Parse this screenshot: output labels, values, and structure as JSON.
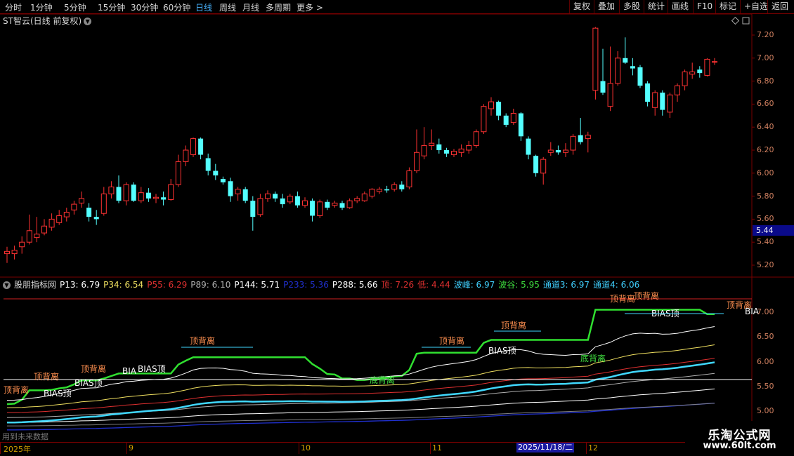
{
  "toolbar": {
    "left_items": [
      "分时",
      "1分钟",
      "5分钟",
      "15分钟",
      "30分钟",
      "60分钟",
      "日线",
      "周线",
      "月线",
      "多周期",
      "更多 >"
    ],
    "active": "日线",
    "right_items": [
      "复权",
      "叠加",
      "多股",
      "统计",
      "画线",
      "F10",
      "标记",
      "+自选",
      "返回"
    ]
  },
  "stock": {
    "title": "ST智云(日线 前复权)"
  },
  "price_axis": {
    "ticks": [
      "7.20",
      "7.00",
      "6.80",
      "6.60",
      "6.40",
      "6.20",
      "6.00",
      "5.80",
      "5.60",
      "5.40",
      "5.20"
    ],
    "current": "5.44"
  },
  "indicator": {
    "name": "股朋指标网",
    "values": [
      {
        "text": "P13: 6.79",
        "color": "#ffffff"
      },
      {
        "text": "P34: 6.54",
        "color": "#f0e060"
      },
      {
        "text": "P55: 6.29",
        "color": "#e03030"
      },
      {
        "text": "P89: 6.10",
        "color": "#b0b0b0"
      },
      {
        "text": "P144: 5.71",
        "color": "#ffffff"
      },
      {
        "text": "P233: 5.36",
        "color": "#2030d0"
      },
      {
        "text": "P288: 5.66",
        "color": "#ffffff"
      },
      {
        "text": "顶: 7.26",
        "color": "#e03030"
      },
      {
        "text": "低: 4.44",
        "color": "#e03030"
      },
      {
        "text": "波峰: 6.97",
        "color": "#40d0ff"
      },
      {
        "text": "波谷: 5.95",
        "color": "#40e040"
      },
      {
        "text": "通道3: 6.97",
        "color": "#40d0ff"
      },
      {
        "text": "通道4: 6.06",
        "color": "#40d0ff"
      }
    ],
    "axis_ticks": [
      "7.00",
      "6.50",
      "6.00",
      "5.50",
      "5.00"
    ]
  },
  "annotations": {
    "top_div": "顶背离",
    "bottom_div": "底背离",
    "bias_top": "BIAS顶",
    "bias_short": "BIA"
  },
  "date_axis": {
    "labels": [
      "2025年",
      "9",
      "10",
      "11",
      "12"
    ],
    "current": "2025/11/18/二"
  },
  "footer": {
    "future_note": "用到未来数据"
  },
  "watermark": {
    "name": "乐淘公式网",
    "url": "www.60lt.com"
  },
  "chart_data": {
    "type": "candlestick",
    "title": "ST智云(日线 前复权)",
    "ylim": [
      5.1,
      7.35
    ],
    "candles": [
      {
        "o": 5.3,
        "c": 5.32,
        "h": 5.36,
        "l": 5.22
      },
      {
        "o": 5.3,
        "c": 5.33,
        "h": 5.37,
        "l": 5.25
      },
      {
        "o": 5.36,
        "c": 5.4,
        "h": 5.45,
        "l": 5.3
      },
      {
        "o": 5.4,
        "c": 5.5,
        "h": 5.64,
        "l": 5.38
      },
      {
        "o": 5.44,
        "c": 5.47,
        "h": 5.62,
        "l": 5.4
      },
      {
        "o": 5.48,
        "c": 5.54,
        "h": 5.6,
        "l": 5.46
      },
      {
        "o": 5.53,
        "c": 5.6,
        "h": 5.65,
        "l": 5.5
      },
      {
        "o": 5.57,
        "c": 5.63,
        "h": 5.68,
        "l": 5.55
      },
      {
        "o": 5.62,
        "c": 5.66,
        "h": 5.7,
        "l": 5.58
      },
      {
        "o": 5.68,
        "c": 5.73,
        "h": 5.76,
        "l": 5.64
      },
      {
        "o": 5.74,
        "c": 5.78,
        "h": 5.84,
        "l": 5.7
      },
      {
        "o": 5.7,
        "c": 5.62,
        "h": 5.74,
        "l": 5.58
      },
      {
        "o": 5.62,
        "c": 5.6,
        "h": 5.68,
        "l": 5.55
      },
      {
        "o": 5.65,
        "c": 5.82,
        "h": 5.88,
        "l": 5.63
      },
      {
        "o": 5.82,
        "c": 5.88,
        "h": 5.93,
        "l": 5.78
      },
      {
        "o": 5.88,
        "c": 5.76,
        "h": 5.98,
        "l": 5.74
      },
      {
        "o": 5.76,
        "c": 5.9,
        "h": 5.92,
        "l": 5.72
      },
      {
        "o": 5.9,
        "c": 5.76,
        "h": 5.92,
        "l": 5.75
      },
      {
        "o": 5.76,
        "c": 5.83,
        "h": 5.88,
        "l": 5.74
      },
      {
        "o": 5.83,
        "c": 5.78,
        "h": 5.87,
        "l": 5.75
      },
      {
        "o": 5.78,
        "c": 5.79,
        "h": 5.82,
        "l": 5.74
      },
      {
        "o": 5.79,
        "c": 5.77,
        "h": 5.84,
        "l": 5.72
      },
      {
        "o": 5.77,
        "c": 5.9,
        "h": 5.95,
        "l": 5.76
      },
      {
        "o": 5.9,
        "c": 6.1,
        "h": 6.16,
        "l": 5.88
      },
      {
        "o": 6.1,
        "c": 6.2,
        "h": 6.24,
        "l": 6.06
      },
      {
        "o": 6.16,
        "c": 6.3,
        "h": 6.31,
        "l": 6.14
      },
      {
        "o": 6.3,
        "c": 6.16,
        "h": 6.31,
        "l": 6.12
      },
      {
        "o": 6.13,
        "c": 6.02,
        "h": 6.17,
        "l": 5.98
      },
      {
        "o": 6.02,
        "c": 5.98,
        "h": 6.08,
        "l": 5.94
      },
      {
        "o": 5.95,
        "c": 5.92,
        "h": 5.97,
        "l": 5.9
      },
      {
        "o": 5.93,
        "c": 5.8,
        "h": 5.96,
        "l": 5.75
      },
      {
        "o": 5.82,
        "c": 5.86,
        "h": 5.88,
        "l": 5.76
      },
      {
        "o": 5.86,
        "c": 5.76,
        "h": 5.88,
        "l": 5.74
      },
      {
        "o": 5.76,
        "c": 5.62,
        "h": 5.8,
        "l": 5.5
      },
      {
        "o": 5.64,
        "c": 5.78,
        "h": 5.82,
        "l": 5.62
      },
      {
        "o": 5.78,
        "c": 5.82,
        "h": 5.85,
        "l": 5.75
      },
      {
        "o": 5.82,
        "c": 5.78,
        "h": 5.84,
        "l": 5.75
      },
      {
        "o": 5.78,
        "c": 5.73,
        "h": 5.82,
        "l": 5.7
      },
      {
        "o": 5.75,
        "c": 5.8,
        "h": 5.82,
        "l": 5.73
      },
      {
        "o": 5.8,
        "c": 5.72,
        "h": 5.84,
        "l": 5.7
      },
      {
        "o": 5.72,
        "c": 5.76,
        "h": 5.79,
        "l": 5.7
      },
      {
        "o": 5.76,
        "c": 5.63,
        "h": 5.78,
        "l": 5.58
      },
      {
        "o": 5.63,
        "c": 5.75,
        "h": 5.77,
        "l": 5.61
      },
      {
        "o": 5.75,
        "c": 5.7,
        "h": 5.77,
        "l": 5.68
      },
      {
        "o": 5.72,
        "c": 5.74,
        "h": 5.76,
        "l": 5.7
      },
      {
        "o": 5.74,
        "c": 5.7,
        "h": 5.76,
        "l": 5.68
      },
      {
        "o": 5.7,
        "c": 5.76,
        "h": 5.78,
        "l": 5.69
      },
      {
        "o": 5.76,
        "c": 5.78,
        "h": 5.8,
        "l": 5.74
      },
      {
        "o": 5.76,
        "c": 5.82,
        "h": 5.84,
        "l": 5.75
      },
      {
        "o": 5.8,
        "c": 5.86,
        "h": 5.87,
        "l": 5.78
      },
      {
        "o": 5.84,
        "c": 5.86,
        "h": 5.88,
        "l": 5.82
      },
      {
        "o": 5.86,
        "c": 5.85,
        "h": 5.89,
        "l": 5.83
      },
      {
        "o": 5.86,
        "c": 5.9,
        "h": 5.92,
        "l": 5.84
      },
      {
        "o": 5.9,
        "c": 5.86,
        "h": 5.93,
        "l": 5.84
      },
      {
        "o": 5.88,
        "c": 6.02,
        "h": 6.05,
        "l": 5.86
      },
      {
        "o": 6.02,
        "c": 6.18,
        "h": 6.38,
        "l": 6.0
      },
      {
        "o": 6.15,
        "c": 6.24,
        "h": 6.4,
        "l": 6.12
      },
      {
        "o": 6.24,
        "c": 6.26,
        "h": 6.38,
        "l": 6.2
      },
      {
        "o": 6.25,
        "c": 6.2,
        "h": 6.3,
        "l": 6.17
      },
      {
        "o": 6.2,
        "c": 6.17,
        "h": 6.22,
        "l": 6.14
      },
      {
        "o": 6.16,
        "c": 6.19,
        "h": 6.21,
        "l": 6.14
      },
      {
        "o": 6.18,
        "c": 6.21,
        "h": 6.25,
        "l": 6.14
      },
      {
        "o": 6.2,
        "c": 6.24,
        "h": 6.28,
        "l": 6.17
      },
      {
        "o": 6.24,
        "c": 6.36,
        "h": 6.38,
        "l": 6.22
      },
      {
        "o": 6.36,
        "c": 6.58,
        "h": 6.6,
        "l": 6.34
      },
      {
        "o": 6.56,
        "c": 6.62,
        "h": 6.66,
        "l": 6.5
      },
      {
        "o": 6.62,
        "c": 6.5,
        "h": 6.63,
        "l": 6.46
      },
      {
        "o": 6.5,
        "c": 6.42,
        "h": 6.52,
        "l": 6.4
      },
      {
        "o": 6.44,
        "c": 6.52,
        "h": 6.56,
        "l": 6.42
      },
      {
        "o": 6.52,
        "c": 6.32,
        "h": 6.53,
        "l": 6.28
      },
      {
        "o": 6.3,
        "c": 6.16,
        "h": 6.32,
        "l": 6.12
      },
      {
        "o": 6.15,
        "c": 6.0,
        "h": 6.16,
        "l": 5.97
      },
      {
        "o": 6.0,
        "c": 6.12,
        "h": 6.14,
        "l": 5.9
      },
      {
        "o": 6.18,
        "c": 6.2,
        "h": 6.27,
        "l": 6.15
      },
      {
        "o": 6.2,
        "c": 6.18,
        "h": 6.24,
        "l": 6.16
      },
      {
        "o": 6.18,
        "c": 6.2,
        "h": 6.26,
        "l": 6.14
      },
      {
        "o": 6.2,
        "c": 6.32,
        "h": 6.34,
        "l": 6.16
      },
      {
        "o": 6.33,
        "c": 6.27,
        "h": 6.48,
        "l": 6.25
      },
      {
        "o": 6.3,
        "c": 6.33,
        "h": 6.36,
        "l": 6.18
      },
      {
        "o": 6.72,
        "c": 7.26,
        "h": 7.27,
        "l": 6.64
      },
      {
        "o": 6.8,
        "c": 6.7,
        "h": 7.08,
        "l": 6.68
      },
      {
        "o": 6.58,
        "c": 6.78,
        "h": 7.1,
        "l": 6.54
      },
      {
        "o": 6.78,
        "c": 7.0,
        "h": 7.06,
        "l": 6.76
      },
      {
        "o": 7.0,
        "c": 6.96,
        "h": 7.18,
        "l": 6.95
      },
      {
        "o": 6.93,
        "c": 6.91,
        "h": 7.0,
        "l": 6.85
      },
      {
        "o": 6.92,
        "c": 6.76,
        "h": 6.94,
        "l": 6.74
      },
      {
        "o": 6.78,
        "c": 6.62,
        "h": 6.8,
        "l": 6.58
      },
      {
        "o": 6.57,
        "c": 6.7,
        "h": 6.72,
        "l": 6.5
      },
      {
        "o": 6.7,
        "c": 6.55,
        "h": 6.72,
        "l": 6.5
      },
      {
        "o": 6.53,
        "c": 6.68,
        "h": 6.7,
        "l": 6.48
      },
      {
        "o": 6.68,
        "c": 6.76,
        "h": 6.78,
        "l": 6.62
      },
      {
        "o": 6.76,
        "c": 6.88,
        "h": 6.9,
        "l": 6.72
      },
      {
        "o": 6.86,
        "c": 6.88,
        "h": 6.96,
        "l": 6.82
      },
      {
        "o": 6.9,
        "c": 6.87,
        "h": 6.93,
        "l": 6.83
      },
      {
        "o": 6.85,
        "c": 6.99,
        "h": 7.0,
        "l": 6.84
      },
      {
        "o": 6.97,
        "c": 6.97,
        "h": 7.0,
        "l": 6.94
      }
    ]
  }
}
